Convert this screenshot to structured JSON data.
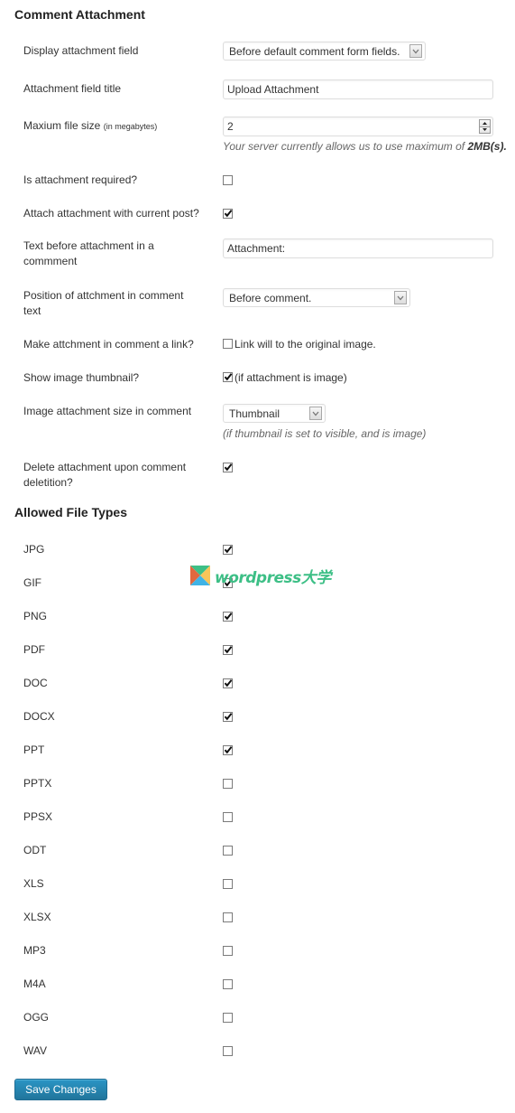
{
  "sections": {
    "comment_attachment": "Comment Attachment",
    "allowed_file_types": "Allowed File Types"
  },
  "settings": {
    "display_field": {
      "label": "Display attachment field",
      "value": "Before default comment form fields."
    },
    "field_title": {
      "label": "Attachment field title",
      "value": "Upload Attachment"
    },
    "max_size": {
      "label": "Maxium file size",
      "label_small": "(in megabytes)",
      "value": "2",
      "hint_prefix": "Your server currently allows us to use maximum of ",
      "hint_bold": "2MB(s)."
    },
    "required": {
      "label": "Is attachment required?",
      "checked": false
    },
    "attach_post": {
      "label": "Attach attachment with current post?",
      "checked": true
    },
    "text_before": {
      "label": "Text before attachment in a commment",
      "value": "Attachment:"
    },
    "position": {
      "label": "Position of attchment in comment text",
      "value": "Before comment."
    },
    "make_link": {
      "label": "Make attchment in comment a link?",
      "checked": false,
      "option_label": "Link will to the original image."
    },
    "show_thumb": {
      "label": "Show image thumbnail?",
      "checked": true,
      "option_label": "(if attachment is image)"
    },
    "image_size": {
      "label": "Image attachment size in comment",
      "value": "Thumbnail",
      "hint": "(if thumbnail is set to visible, and is image)"
    },
    "delete_on_delete": {
      "label": "Delete attachment upon comment deletition?",
      "checked": true
    }
  },
  "file_types": [
    {
      "label": "JPG",
      "checked": true
    },
    {
      "label": "GIF",
      "checked": true
    },
    {
      "label": "PNG",
      "checked": true
    },
    {
      "label": "PDF",
      "checked": true
    },
    {
      "label": "DOC",
      "checked": true
    },
    {
      "label": "DOCX",
      "checked": true
    },
    {
      "label": "PPT",
      "checked": true
    },
    {
      "label": "PPTX",
      "checked": false
    },
    {
      "label": "PPSX",
      "checked": false
    },
    {
      "label": "ODT",
      "checked": false
    },
    {
      "label": "XLS",
      "checked": false
    },
    {
      "label": "XLSX",
      "checked": false
    },
    {
      "label": "MP3",
      "checked": false
    },
    {
      "label": "M4A",
      "checked": false
    },
    {
      "label": "OGG",
      "checked": false
    },
    {
      "label": "WAV",
      "checked": false
    }
  ],
  "buttons": {
    "save": "Save Changes"
  },
  "watermark": {
    "text": "wordpress大学",
    "colors": {
      "green": "#3dbf86",
      "orange": "#e0683f",
      "yellow": "#f7c55a",
      "blue": "#3fb3e6"
    }
  },
  "colors": {
    "primary_button": "#2383b0",
    "text": "#333333",
    "hint": "#666666"
  }
}
